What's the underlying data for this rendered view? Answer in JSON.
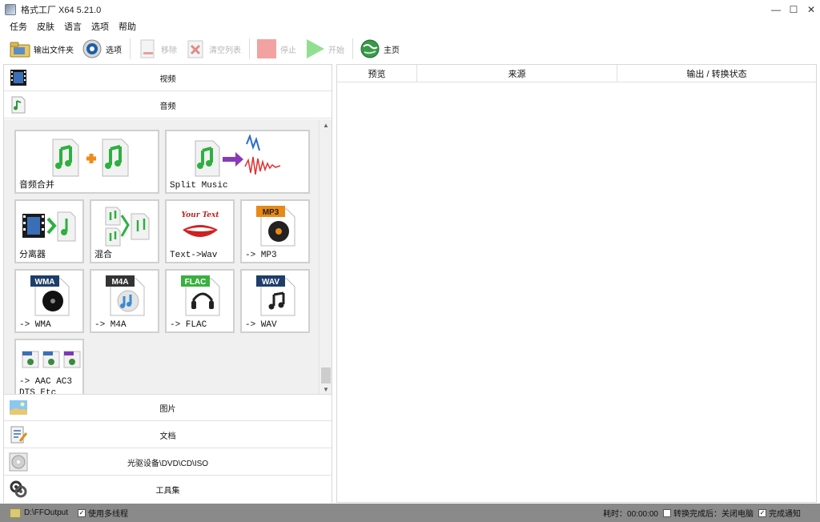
{
  "window": {
    "title": "格式工厂 X64 5.21.0",
    "controls": {
      "minimize": "—",
      "maximize": "☐",
      "close": "✕"
    }
  },
  "menu": [
    "任务",
    "皮肤",
    "语言",
    "选项",
    "帮助"
  ],
  "toolbar": {
    "output_folder": "输出文件夹",
    "options": "选项",
    "remove": "移除",
    "clear_list": "清空列表",
    "stop": "停止",
    "start": "开始",
    "home": "主页"
  },
  "categories": {
    "video": "视频",
    "audio": "音频",
    "picture": "图片",
    "document": "文档",
    "optical": "光驱设备\\DVD\\CD\\ISO",
    "tools": "工具集"
  },
  "audio_tiles": {
    "merge": "音频合并",
    "split": "Split Music",
    "splitter": "分离器",
    "mix": "混合",
    "text_wav": "Text->Wav",
    "mp3": "-> MP3",
    "wma": "-> WMA",
    "m4a": "-> M4A",
    "flac": "-> FLAC",
    "wav": "-> WAV",
    "aac_line1": "-> AAC AC3",
    "aac_line2": "DTS Etc",
    "badge_mp3": "MP3",
    "badge_wma": "WMA",
    "badge_m4a": "M4A",
    "badge_flac": "FLAC",
    "badge_wav": "WAV",
    "your_text": "Your Text"
  },
  "table": {
    "columns": [
      "预览",
      "来源",
      "输出 / 转换状态"
    ]
  },
  "status": {
    "output_path": "D:\\FFOutput",
    "multithread": "使用多线程",
    "elapsed": "耗时：00:00:00",
    "shutdown_after": "转换完成后：关闭电脑",
    "notify": "完成通知"
  },
  "colors": {
    "status_bg": "#8a8a8a",
    "tile_border": "#d0d0d0",
    "audio_area_bg": "#f0f0f0",
    "stop_red": "#f0a0a0",
    "start_green": "#8ee08e"
  }
}
